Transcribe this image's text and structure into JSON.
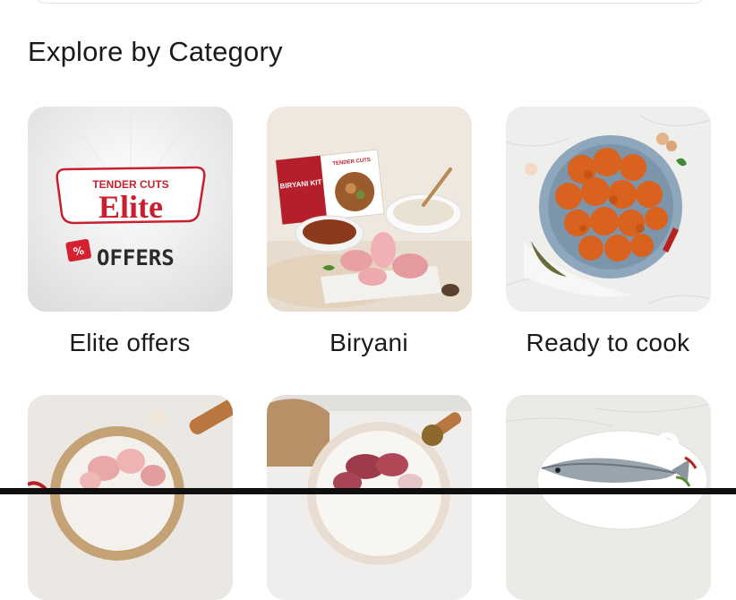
{
  "section": {
    "title": "Explore by Category"
  },
  "categories": [
    {
      "label": "Elite offers",
      "icon": "elite-offers-image"
    },
    {
      "label": "Biryani",
      "icon": "biryani-kit-image"
    },
    {
      "label": "Ready to cook",
      "icon": "ready-to-cook-image"
    },
    {
      "label": "",
      "icon": "chicken-image"
    },
    {
      "label": "",
      "icon": "mutton-image"
    },
    {
      "label": "",
      "icon": "fish-image"
    }
  ],
  "elite_badge": {
    "brand": "TENDER CUTS",
    "name": "Elite",
    "subtitle": "OFFERS"
  },
  "biryani_box": {
    "title": "BIRYANI KIT",
    "brand": "TENDER CUTS"
  },
  "colors": {
    "brand_red": "#c8202f",
    "text": "#1a1a1a"
  }
}
